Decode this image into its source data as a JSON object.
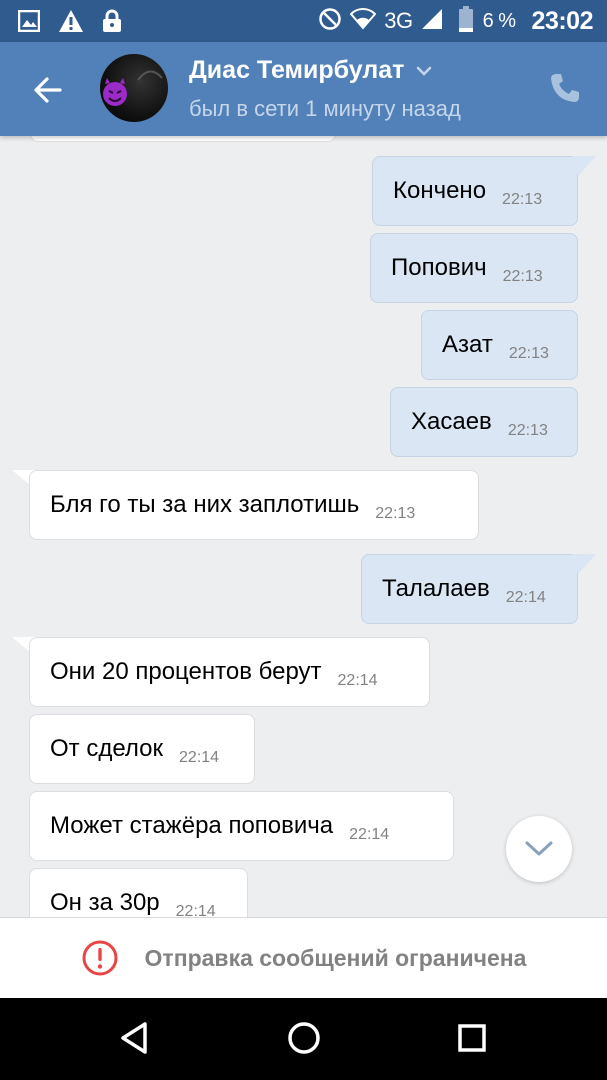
{
  "status_bar": {
    "network": "3G",
    "battery": "6 %",
    "time": "23:02",
    "icons": [
      "image-icon",
      "warning-icon",
      "lock-icon",
      "do-not-disturb-icon",
      "wifi-icon",
      "signal-icon",
      "battery-icon"
    ]
  },
  "header": {
    "contact_name": "Диас Темирбулат",
    "status": "был в сети 1 минуту назад",
    "accent": "#5181b8"
  },
  "messages": [
    {
      "dir": "out",
      "text": "Кончено",
      "time": "22:13"
    },
    {
      "dir": "out",
      "text": "Попович",
      "time": "22:13"
    },
    {
      "dir": "out",
      "text": "Азат",
      "time": "22:13"
    },
    {
      "dir": "out",
      "text": "Хасаев",
      "time": "22:13"
    },
    {
      "dir": "in",
      "text": "Бля го ты за них заплотишь",
      "time": "22:13"
    },
    {
      "dir": "out",
      "text": "Талалаев",
      "time": "22:14"
    },
    {
      "dir": "in",
      "text": "Они 20 процентов берут",
      "time": "22:14"
    },
    {
      "dir": "in",
      "text": "От сделок",
      "time": "22:14"
    },
    {
      "dir": "in",
      "text": "Может стажёра поповича",
      "time": "22:14"
    },
    {
      "dir": "in",
      "text": "Он за 30р",
      "time": "22:14"
    }
  ],
  "restriction": {
    "text": "Отправка сообщений ограничена",
    "color": "#e64646"
  }
}
